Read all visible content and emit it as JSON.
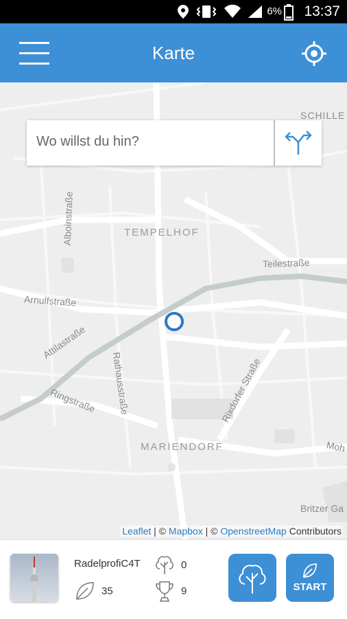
{
  "status_bar": {
    "battery_percent": "6%",
    "time": "13:37"
  },
  "app_bar": {
    "title": "Karte"
  },
  "search": {
    "placeholder": "Wo willst du hin?"
  },
  "map": {
    "labels": {
      "tempelhof": "TEMPELHOF",
      "mariendorf": "MARIENDORF",
      "schiller": "SCHILLE",
      "teilestrasse": "Teilestraße",
      "arnulfstrasse": "Arnulfstraße",
      "attilastrasse": "Attilastraße",
      "ringstrasse": "Ringstraße",
      "rathausstrasse": "Rathausstraße",
      "rixdorfer": "Rixdorfer Straße",
      "alboinstrasse": "Alboinstraße",
      "britzer": "Britzer Ga",
      "moh": "Moh"
    },
    "attribution": {
      "leaflet": "Leaflet",
      "sep1": " | © ",
      "mapbox": "Mapbox",
      "sep2": " | © ",
      "osm": "OpenstreetMap",
      "contributors": " Contributors"
    }
  },
  "user": {
    "name": "RadelprofiC4T",
    "trees": "0",
    "leaves": "35",
    "trophies": "9"
  },
  "buttons": {
    "start_label": "START"
  },
  "colors": {
    "primary": "#3d8fd6",
    "map_background": "#eeeeee",
    "location_marker": "#2a7ac0"
  }
}
